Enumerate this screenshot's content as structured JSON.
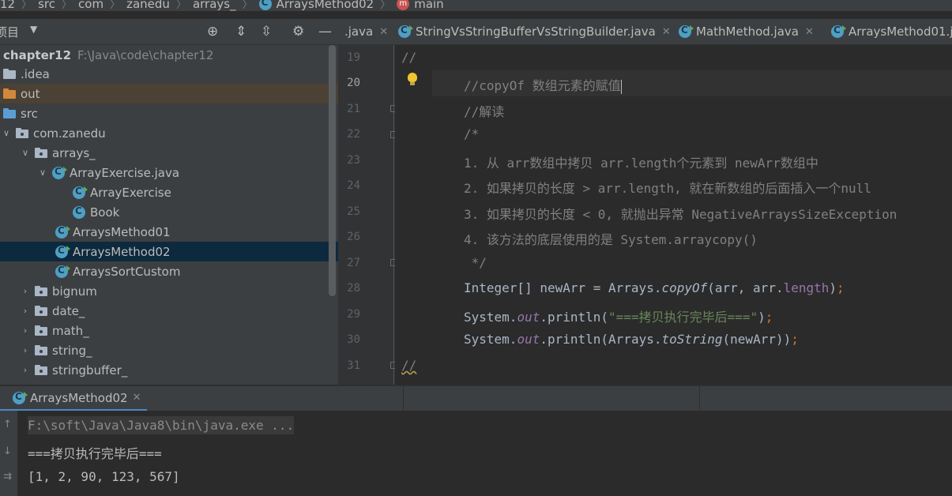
{
  "breadcrumb": [
    "12",
    "src",
    "com",
    "zanedu",
    "arrays_",
    "ArraysMethod02",
    "main"
  ],
  "project_header": {
    "title": "项目"
  },
  "tree": {
    "root": {
      "name": "chapter12",
      "path": "F:\\Java\\code\\chapter12"
    },
    "items": [
      {
        "label": ".idea"
      },
      {
        "label": "out"
      },
      {
        "label": "src"
      },
      {
        "label": "com.zanedu"
      },
      {
        "label": "arrays_"
      },
      {
        "label": "ArrayExercise.java"
      },
      {
        "label": "ArrayExercise"
      },
      {
        "label": "Book"
      },
      {
        "label": "ArraysMethod01"
      },
      {
        "label": "ArraysMethod02"
      },
      {
        "label": "ArraysSortCustom"
      },
      {
        "label": "bignum"
      },
      {
        "label": "date_"
      },
      {
        "label": "math_"
      },
      {
        "label": "string_"
      },
      {
        "label": "stringbuffer_"
      }
    ]
  },
  "tabs": [
    {
      "label": ".java"
    },
    {
      "label": "StringVsStringBufferVsStringBuilder.java"
    },
    {
      "label": "MathMethod.java"
    },
    {
      "label": "ArraysMethod01.j"
    }
  ],
  "gutter": {
    "lines": [
      "19",
      "20",
      "21",
      "22",
      "23",
      "24",
      "25",
      "26",
      "27",
      "28",
      "29",
      "30",
      "31"
    ]
  },
  "code": {
    "l19": "//",
    "l20": "//copyOf 数组元素的赋值",
    "l21": "//解读",
    "l22": "/*",
    "l23": "1. 从 arr数组中拷贝 arr.length个元素到 newArr数组中",
    "l24": "2. 如果拷贝的长度 > arr.length, 就在新数组的后面插入一个null",
    "l25": "3. 如果拷贝的长度 < 0, 就抛出异常 NegativeArraysSizeException",
    "l26": "4. 该方法的底层使用的是 System.arraycopy()",
    "l27": " */",
    "l28": {
      "a": "Integer[] newArr = Arrays.",
      "b": "copyOf",
      "c": "(arr, arr.",
      "d": "length",
      "e": ")",
      "f": ";"
    },
    "l29": {
      "a": "System.",
      "b": "out",
      "c": ".println(",
      "d": "\"===拷贝执行完毕后===\"",
      "e": ")",
      "f": ";"
    },
    "l30": {
      "a": "System.",
      "b": "out",
      "c": ".println(Arrays.",
      "d": "toString",
      "e": "(newArr))",
      "f": ";"
    },
    "l31": "//"
  },
  "run": {
    "tab_label": "ArraysMethod02",
    "console": [
      "F:\\soft\\Java\\Java8\\bin\\java.exe ...",
      "===拷贝执行完毕后===",
      "[1, 2, 90, 123, 567]"
    ]
  }
}
